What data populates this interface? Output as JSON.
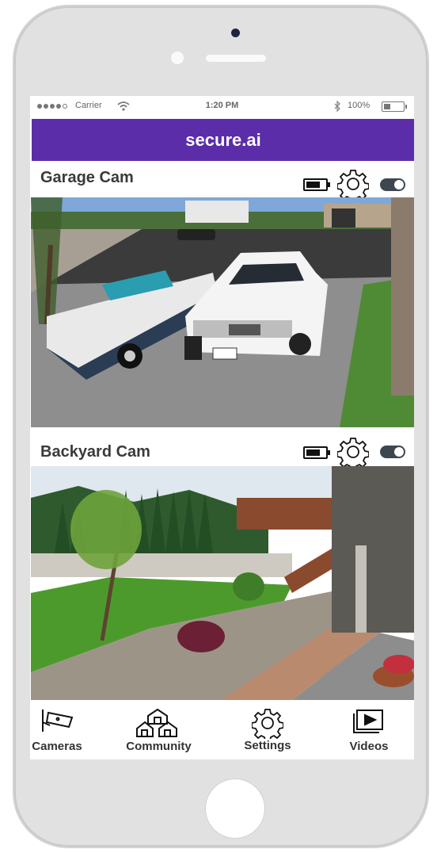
{
  "status_bar": {
    "carrier": "Carrier",
    "time": "1:20 PM",
    "battery": "100%"
  },
  "app": {
    "title": "secure.ai",
    "accent": "#5b2da8"
  },
  "cameras": [
    {
      "name": "Garage Cam",
      "battery_icon": "battery-full-icon",
      "settings_icon": "gear-icon",
      "enabled": true
    },
    {
      "name": "Backyard Cam",
      "battery_icon": "battery-full-icon",
      "settings_icon": "gear-icon",
      "enabled": true
    }
  ],
  "tabs": [
    {
      "label": "Cameras",
      "icon": "security-camera-icon"
    },
    {
      "label": "Community",
      "icon": "houses-icon"
    },
    {
      "label": "Settings",
      "icon": "gear-icon"
    },
    {
      "label": "Videos",
      "icon": "video-player-icon"
    }
  ]
}
